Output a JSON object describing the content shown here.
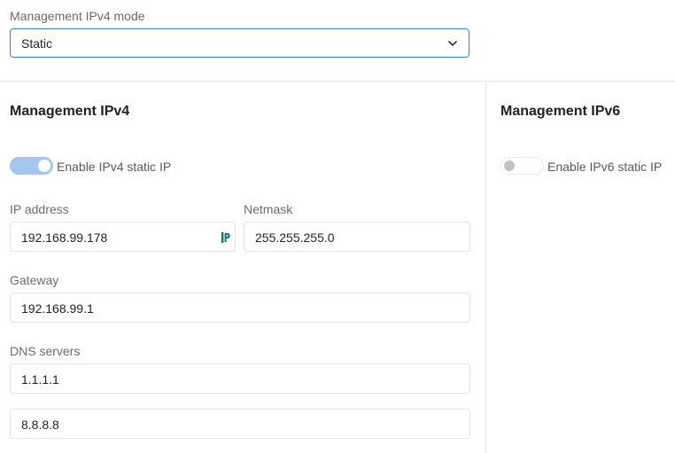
{
  "mode": {
    "label": "Management IPv4 mode",
    "selected": "Static",
    "chevron_icon": "chevron-down-icon"
  },
  "ipv4": {
    "title": "Management IPv4",
    "toggle_label": "Enable IPv4 static IP",
    "toggle_on": true,
    "ip_label": "IP address",
    "ip_value": "192.168.99.178",
    "ip_field_icon": "password-manager-icon",
    "netmask_label": "Netmask",
    "netmask_value": "255.255.255.0",
    "gateway_label": "Gateway",
    "gateway_value": "192.168.99.1",
    "dns_label": "DNS servers",
    "dns_values": [
      "1.1.1.1",
      "8.8.8.8"
    ]
  },
  "ipv6": {
    "title": "Management IPv6",
    "toggle_label": "Enable IPv6 static IP",
    "toggle_on": false
  },
  "colors": {
    "accent": "#3b82c4",
    "toggle_on": "#a5c6ef",
    "icon_teal": "#1b6c7c"
  }
}
